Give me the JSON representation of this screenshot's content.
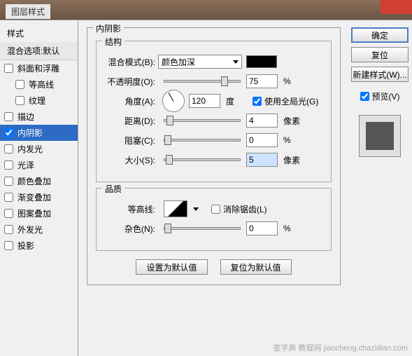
{
  "window": {
    "title": "图层样式"
  },
  "sidebar": {
    "header": "样式",
    "blend_header": "混合选项:默认",
    "items": [
      {
        "label": "斜面和浮雕",
        "checked": false
      },
      {
        "label": "等高线",
        "checked": false,
        "indent": true
      },
      {
        "label": "纹理",
        "checked": false,
        "indent": true
      },
      {
        "label": "描边",
        "checked": false
      },
      {
        "label": "内阴影",
        "checked": true,
        "selected": true
      },
      {
        "label": "内发光",
        "checked": false
      },
      {
        "label": "光泽",
        "checked": false
      },
      {
        "label": "颜色叠加",
        "checked": false
      },
      {
        "label": "渐变叠加",
        "checked": false
      },
      {
        "label": "图案叠加",
        "checked": false
      },
      {
        "label": "外发光",
        "checked": false
      },
      {
        "label": "投影",
        "checked": false
      }
    ]
  },
  "panel": {
    "title": "内阴影",
    "structure": {
      "title": "结构",
      "blend_mode_label": "混合模式(B):",
      "blend_mode_value": "颜色加深",
      "color": "#000000",
      "opacity_label": "不透明度(O):",
      "opacity_value": "75",
      "opacity_unit": "%",
      "angle_label": "角度(A):",
      "angle_value": "120",
      "angle_unit": "度",
      "global_light_label": "使用全局光(G)",
      "global_light_checked": true,
      "distance_label": "距离(D):",
      "distance_value": "4",
      "distance_unit": "像素",
      "choke_label": "阻塞(C):",
      "choke_value": "0",
      "choke_unit": "%",
      "size_label": "大小(S):",
      "size_value": "5",
      "size_unit": "像素"
    },
    "quality": {
      "title": "品质",
      "contour_label": "等高线:",
      "antialiased_label": "消除锯齿(L)",
      "antialiased_checked": false,
      "noise_label": "杂色(N):",
      "noise_value": "0",
      "noise_unit": "%"
    },
    "buttons": {
      "make_default": "设置为默认值",
      "reset_default": "复位为默认值"
    }
  },
  "rightcol": {
    "ok": "确定",
    "cancel": "复位",
    "new_style": "新建样式(W)...",
    "preview_label": "预览(V)",
    "preview_checked": true
  },
  "watermark": "查字典 教程网 jiaocheng.chazidian.com"
}
